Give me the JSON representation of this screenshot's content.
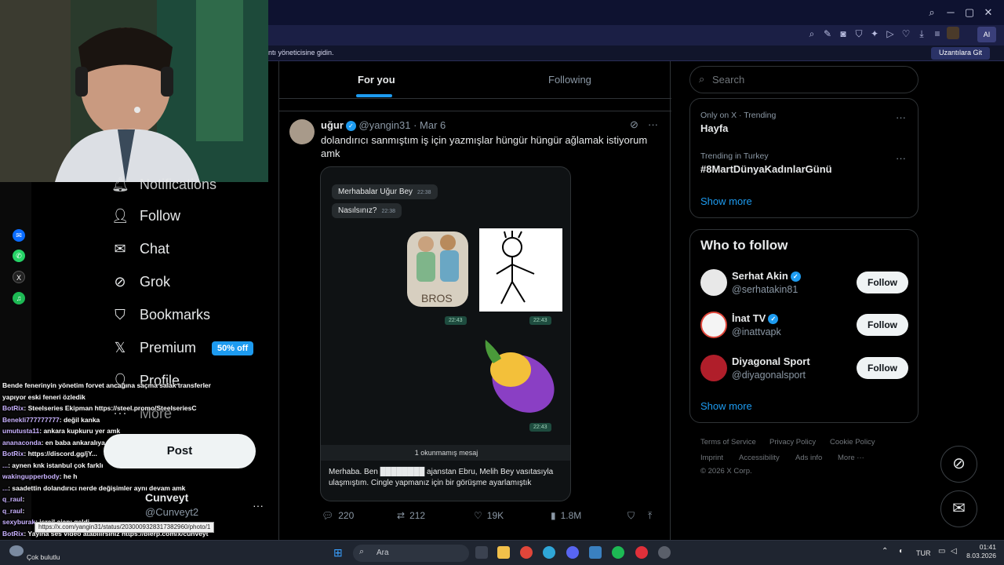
{
  "browser": {
    "info_message": "ntı yöneticisine gidin.",
    "info_button": "Uzantılara Git",
    "ai_button": "AI"
  },
  "nav": {
    "notifications": "Notifications",
    "follow": "Follow",
    "chat": "Chat",
    "grok": "Grok",
    "bookmarks": "Bookmarks",
    "premium": "Premium",
    "premium_badge": "50% off",
    "profile": "Profile",
    "more": "More",
    "post": "Post"
  },
  "account": {
    "name": "Cunveyt",
    "handle": "@Cunveyt2"
  },
  "chat_lines": [
    {
      "user": "",
      "text": "Bende fenerinyin yönetim forvet ancağına saçma salak transferler"
    },
    {
      "user": "",
      "text": "yapıyor eski feneri özledik"
    },
    {
      "user": "BotRix",
      "text": ": Steelseries Ekipman https://steel.promo/SteelseriesC"
    },
    {
      "user": "Benekli777777777",
      "text": ": değil kanka"
    },
    {
      "user": "umutusta11",
      "text": ": ankara kupkuru yer amk"
    },
    {
      "user": "ananaconda",
      "text": ": en baba ankaralıya sor o da 300 der"
    },
    {
      "user": "BotRix",
      "text": ": https://discord.gg/jY..."
    },
    {
      "user": "...",
      "text": ": aynen knk istanbul çok farklı"
    },
    {
      "user": "wakingupperbody",
      "text": ": he h"
    },
    {
      "user": "...",
      "text": ": saadettin dolandırıcı nerde değişimler aynı devam amk"
    },
    {
      "user": "q_raul",
      "text": ":"
    },
    {
      "user": "q_raul",
      "text": ":"
    },
    {
      "user": "sexyburak",
      "text": ": israil ajanı geldi"
    },
    {
      "user": "BotRix",
      "text": ": Yayına ses video atabilirsiniz https://blerp.com/x/cunveyt"
    }
  ],
  "url_tooltip": "https://x.com/yangin31/status/2030009328317382960/photo/1",
  "feed": {
    "tab_foryou": "For you",
    "tab_following": "Following",
    "tweet": {
      "name": "uğur",
      "handle": "@yangin31",
      "date": "· Mar 6",
      "text": "dolandırıcı sanmıştım iş için yazmışlar hüngür hüngür ağlamak istiyorum amk",
      "replies": "220",
      "reposts": "212",
      "likes": "19K",
      "views": "1.8M"
    },
    "media": {
      "msg1": "Merhabalar Uğur Bey",
      "msg1_time": "22:38",
      "msg2": "Nasılsınız?",
      "msg2_time": "22:38",
      "sticker_time1": "22:43",
      "sticker_time2": "22:43",
      "sticker_time3": "22:43",
      "sticker_label": "BROS",
      "unread": "1 okunmamış mesaj",
      "reply_text": "Merhaba. Ben ████████ ajanstan Ebru, Melih Bey vasıtasıyla ulaşmıştım. Cingle yapmanız için bir görüşme ayarlamıştık"
    }
  },
  "right": {
    "search_placeholder": "Search",
    "trends": [
      {
        "context": "Only on X · Trending",
        "title": "Hayfa"
      },
      {
        "context": "Trending in Turkey",
        "title": "#8MartDünyaKadınlarGünü"
      }
    ],
    "show_more": "Show more",
    "who_to_follow": "Who to follow",
    "accounts": [
      {
        "name": "Serhat Akin",
        "handle": "@serhatakin81",
        "verified": true,
        "button": "Follow"
      },
      {
        "name": "İnat TV",
        "handle": "@inattvapk",
        "verified": true,
        "button": "Follow"
      },
      {
        "name": "Diyagonal Sport",
        "handle": "@diyagonalsport",
        "verified": false,
        "button": "Follow"
      }
    ],
    "show_more_2": "Show more",
    "footer": [
      "Terms of Service",
      "Privacy Policy",
      "Cookie Policy",
      "Imprint",
      "Accessibility",
      "Ads info",
      "More ···"
    ],
    "copyright": "© 2026 X Corp."
  },
  "taskbar": {
    "search": "Ara",
    "lang": "TUR",
    "time": "01:41",
    "date": "8.03.2026",
    "weather": "Çok bulutlu"
  },
  "colors": {
    "accent": "#1d9bf0",
    "background": "#000000",
    "browser_chrome": "#1b1f45"
  }
}
